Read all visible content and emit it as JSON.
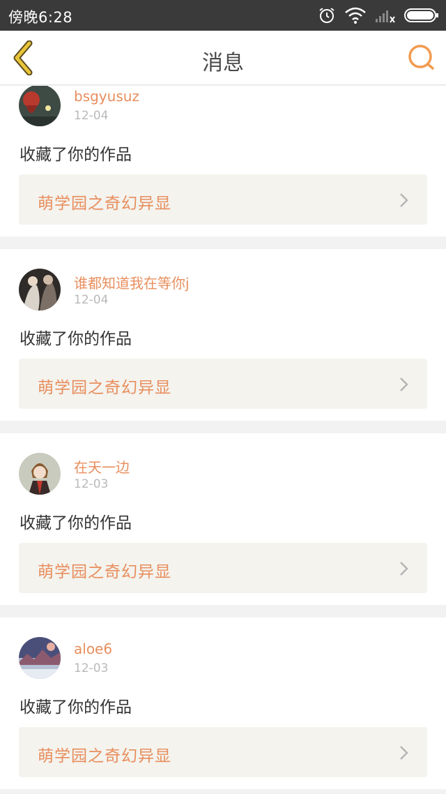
{
  "status_bar": {
    "time": "傍晚6:28",
    "icons": [
      "alarm-icon",
      "wifi-icon",
      "signal-icon",
      "battery-icon"
    ]
  },
  "header": {
    "title": "消息",
    "back_icon": "chevron-left-icon",
    "search_icon": "search-icon",
    "accent_color": "#f29a4f",
    "back_color": "#e8c43a"
  },
  "messages": [
    {
      "username": "bsgyusuz",
      "date": "12-04",
      "action": "收藏了你的作品",
      "work_title": "萌学园之奇幻异显"
    },
    {
      "username": "谁都知道我在等你j",
      "date": "12-04",
      "action": "收藏了你的作品",
      "work_title": "萌学园之奇幻异显"
    },
    {
      "username": "在天一边",
      "date": "12-03",
      "action": "收藏了你的作品",
      "work_title": "萌学园之奇幻异显"
    },
    {
      "username": "aloe6",
      "date": "12-03",
      "action": "收藏了你的作品",
      "work_title": "萌学园之奇幻异显"
    }
  ],
  "colors": {
    "username": "#e88e5d",
    "date": "#b9b9b9",
    "work_box_bg": "#f4f3ee",
    "page_bg": "#f2f2f2"
  }
}
